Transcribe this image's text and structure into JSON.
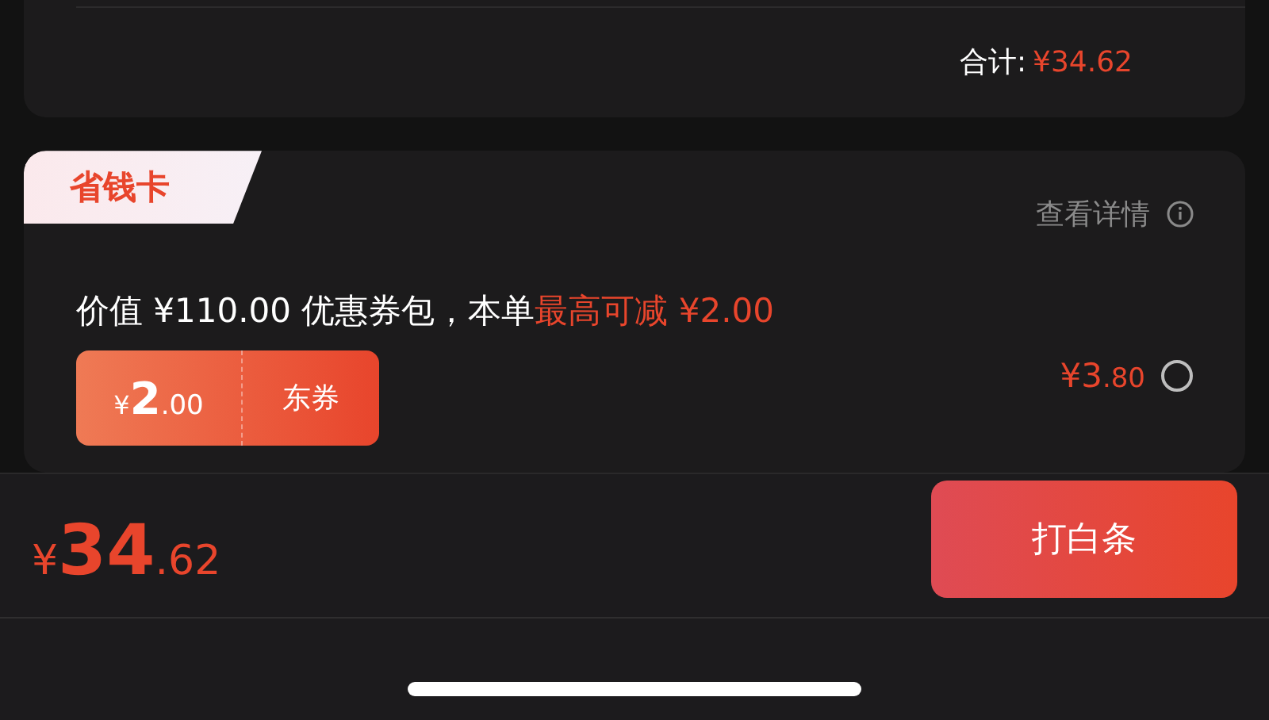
{
  "order_summary": {
    "total_label": "合计:",
    "total_value": "¥34.62"
  },
  "savings_card": {
    "tag": "省钱卡",
    "details_link": "查看详情",
    "description": "价值 ¥110.00 优惠券包，本单**最高可减 ¥2.00**",
    "coupon": {
      "currency": "¥",
      "amount": "2",
      "decimals": ".00",
      "type": "东券"
    },
    "price": {
      "integer": "¥3",
      "decimals": ".80"
    },
    "selected": false
  },
  "bottom_bar": {
    "currency": "¥",
    "amount": "34",
    "decimals": ".62",
    "pay_button": "打白条"
  }
}
